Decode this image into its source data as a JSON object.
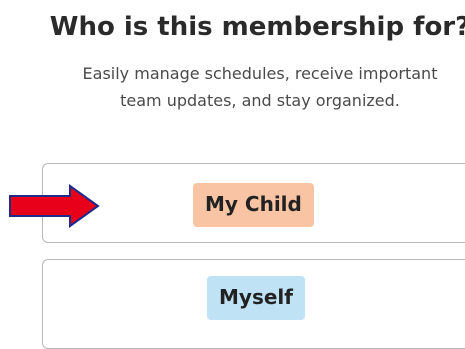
{
  "header": {
    "title": "Who is this membership for?",
    "subtitle": "Easily manage schedules, receive important team updates, and stay organized."
  },
  "options": [
    {
      "label": "My Child",
      "highlight": "#f9c4a4"
    },
    {
      "label": "Myself",
      "highlight": "#bfe2f5"
    }
  ],
  "annotation": {
    "arrow_color": "#e8001a",
    "arrow_outline": "#1f2a8a",
    "points_to": "My Child"
  }
}
